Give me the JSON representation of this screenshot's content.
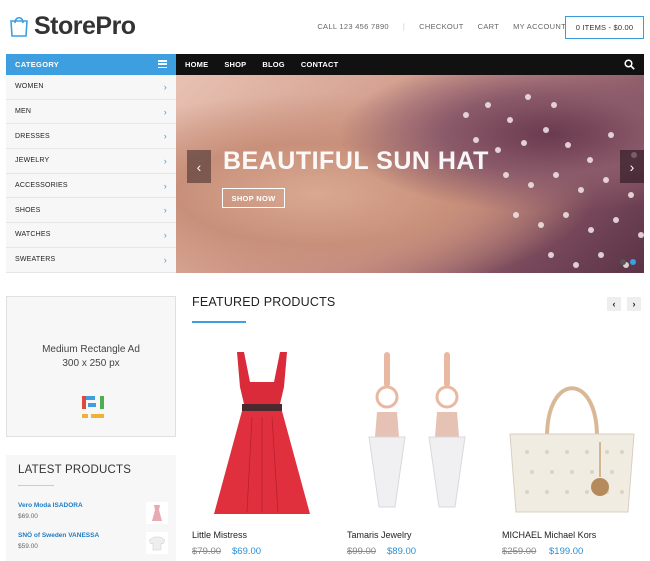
{
  "brand": {
    "name": "StorePro"
  },
  "topnav": {
    "phone": "CALL 123 456 7890",
    "checkout": "CHECKOUT",
    "cart": "CART",
    "account": "MY ACCOUNT",
    "cart_summary": "0 ITEMS - $0.00"
  },
  "category": {
    "header": "CATEGORY",
    "items": [
      {
        "label": "WOMEN"
      },
      {
        "label": "MEN"
      },
      {
        "label": "DRESSES"
      },
      {
        "label": "JEWELRY"
      },
      {
        "label": "ACCESSORIES"
      },
      {
        "label": "SHOES"
      },
      {
        "label": "WATCHES"
      },
      {
        "label": "SWEATERS"
      }
    ]
  },
  "mainnav": {
    "items": [
      {
        "label": "HOME"
      },
      {
        "label": "SHOP"
      },
      {
        "label": "BLOG"
      },
      {
        "label": "CONTACT"
      }
    ]
  },
  "hero": {
    "title": "BEAUTIFUL SUN HAT",
    "button": "SHOP NOW",
    "slide_count": 2,
    "active_slide": 2
  },
  "ad": {
    "title": "Medium Rectangle Ad",
    "size": "300 x 250 px"
  },
  "latest": {
    "title": "LATEST PRODUCTS",
    "items": [
      {
        "name": "Vero Moda ISADORA",
        "price": "$69.00"
      },
      {
        "name": "SNÖ of Sweden VANESSA",
        "price": "$59.00"
      }
    ]
  },
  "featured": {
    "title": "FEATURED PRODUCTS",
    "products": [
      {
        "name": "Little Mistress",
        "old_price": "$79.00",
        "price": "$69.00"
      },
      {
        "name": "Tamaris Jewelry",
        "old_price": "$99.00",
        "price": "$89.00"
      },
      {
        "name": "MICHAEL Michael Kors",
        "old_price": "$259.00",
        "price": "$199.00"
      }
    ]
  },
  "colors": {
    "accent": "#3d9fe0",
    "nav_bg": "#111111",
    "price": "#2a8fd4"
  }
}
